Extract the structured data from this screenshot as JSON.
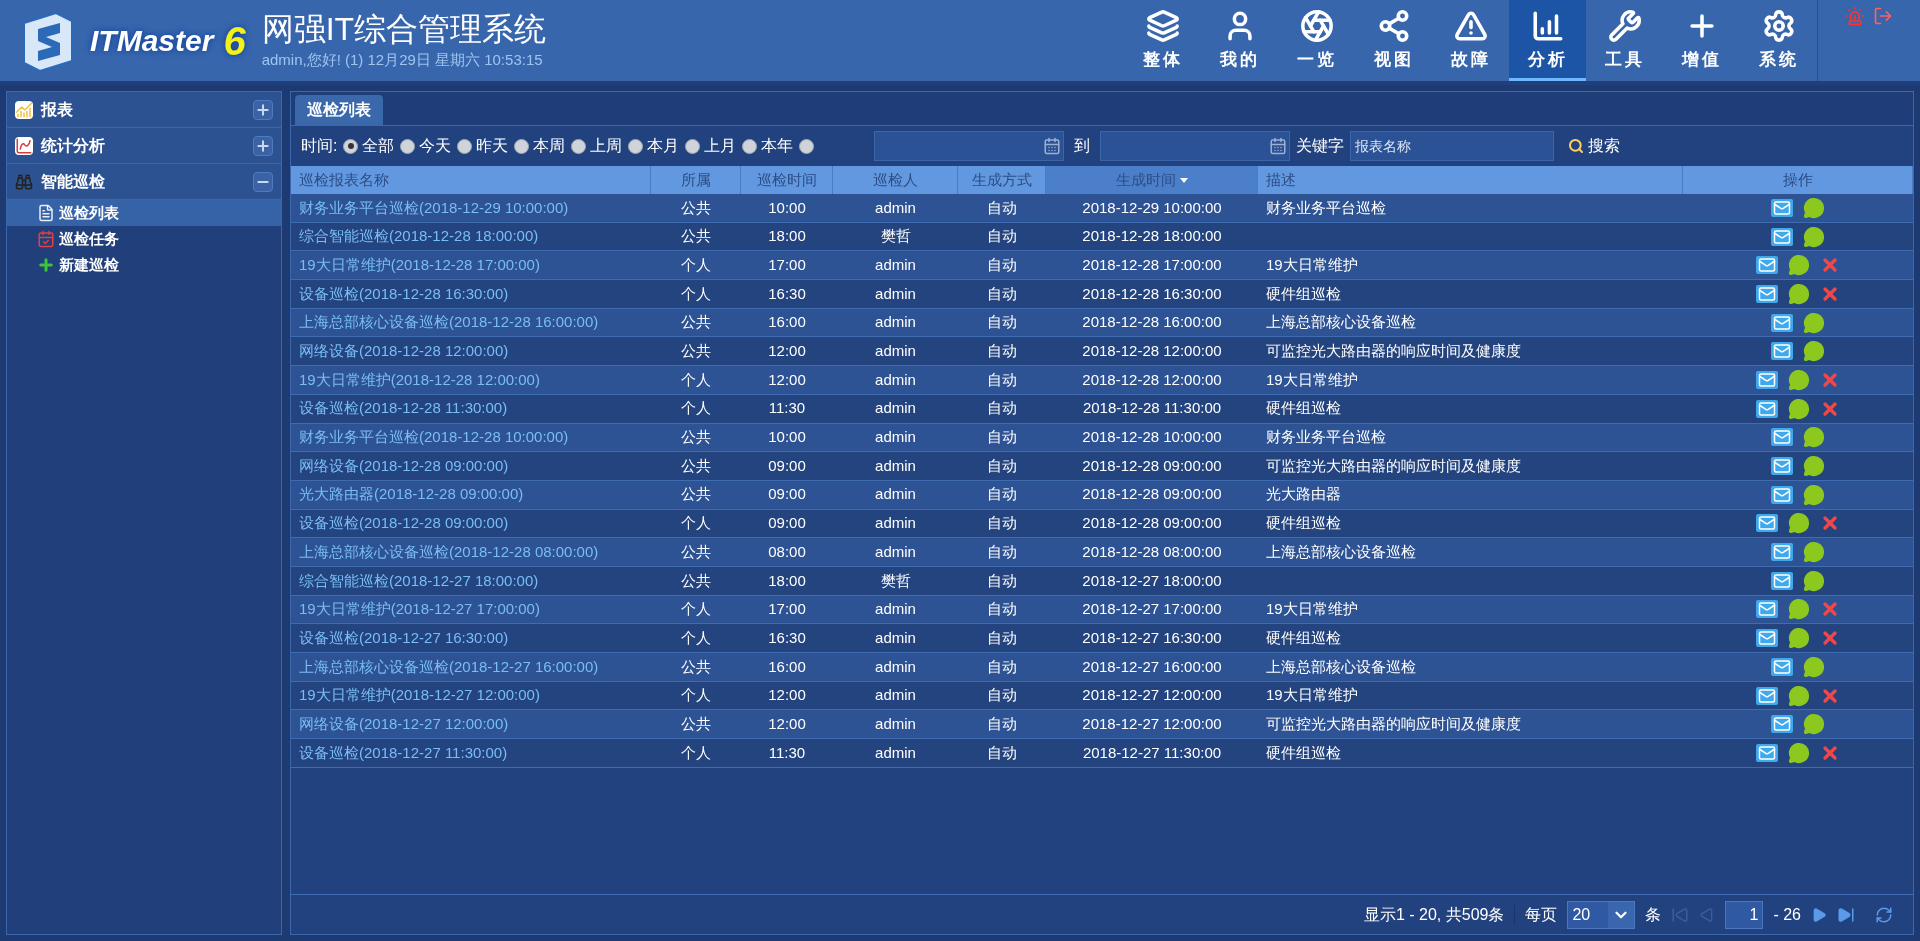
{
  "header": {
    "logo_text": "ITMaster",
    "logo_version": "6",
    "title": "网强IT综合管理系统",
    "subtitle": "admin,您好! (1) 12月29日 星期六 10:53:15"
  },
  "nav": [
    {
      "kind": "layers",
      "label": "整体",
      "selected": false
    },
    {
      "kind": "user",
      "label": "我的",
      "selected": false
    },
    {
      "kind": "overview",
      "label": "一览",
      "selected": false
    },
    {
      "kind": "topology",
      "label": "视图",
      "selected": false
    },
    {
      "kind": "alert",
      "label": "故障",
      "selected": false
    },
    {
      "kind": "chart",
      "label": "分析",
      "selected": true
    },
    {
      "kind": "tools",
      "label": "工具",
      "selected": false
    },
    {
      "kind": "plus",
      "label": "增值",
      "selected": false
    },
    {
      "kind": "gear",
      "label": "系统",
      "selected": false
    }
  ],
  "sidebar": [
    {
      "kind": "report",
      "label": "报表",
      "expanded": false
    },
    {
      "kind": "stats",
      "label": "统计分析",
      "expanded": false
    },
    {
      "kind": "inspect",
      "label": "智能巡检",
      "expanded": true,
      "children": [
        {
          "kind": "list",
          "label": "巡检列表",
          "selected": true
        },
        {
          "kind": "task",
          "label": "巡检任务",
          "selected": false
        },
        {
          "kind": "new",
          "label": "新建巡检",
          "selected": false
        }
      ]
    }
  ],
  "tab": {
    "label": "巡检列表",
    "selected": true
  },
  "filter": {
    "time_label": "时间:",
    "options": [
      {
        "label": "全部",
        "selected": true
      },
      {
        "label": "今天",
        "selected": false
      },
      {
        "label": "昨天",
        "selected": false
      },
      {
        "label": "本周",
        "selected": false
      },
      {
        "label": "上周",
        "selected": false
      },
      {
        "label": "本月",
        "selected": false
      },
      {
        "label": "上月",
        "selected": false
      },
      {
        "label": "本年",
        "selected": false
      }
    ],
    "custom_range_selected": false,
    "to_label": "到",
    "keyword_label": "关键字",
    "keyword_placeholder": "报表名称",
    "search_button": "搜索"
  },
  "table": {
    "columns": [
      {
        "label": "巡检报表名称",
        "sorted": false
      },
      {
        "label": "所属",
        "sorted": false
      },
      {
        "label": "巡检时间",
        "sorted": false
      },
      {
        "label": "巡检人",
        "sorted": false
      },
      {
        "label": "生成方式",
        "sorted": false
      },
      {
        "label": "生成时间",
        "sorted": true
      },
      {
        "label": "描述",
        "sorted": false
      },
      {
        "label": "操作",
        "sorted": false
      }
    ],
    "rows": [
      {
        "name": "财务业务平台巡检(2018-12-29 10:00:00)",
        "owner": "公共",
        "time": "10:00",
        "person": "admin",
        "method": "自动",
        "created": "2018-12-29 10:00:00",
        "desc": "财务业务平台巡检",
        "deletable": false
      },
      {
        "name": "综合智能巡检(2018-12-28 18:00:00)",
        "owner": "公共",
        "time": "18:00",
        "person": "樊哲",
        "method": "自动",
        "created": "2018-12-28 18:00:00",
        "desc": "",
        "deletable": false
      },
      {
        "name": "19大日常维护(2018-12-28 17:00:00)",
        "owner": "个人",
        "time": "17:00",
        "person": "admin",
        "method": "自动",
        "created": "2018-12-28 17:00:00",
        "desc": "19大日常维护",
        "deletable": true
      },
      {
        "name": "设备巡检(2018-12-28 16:30:00)",
        "owner": "个人",
        "time": "16:30",
        "person": "admin",
        "method": "自动",
        "created": "2018-12-28 16:30:00",
        "desc": "硬件组巡检",
        "deletable": true
      },
      {
        "name": "上海总部核心设备巡检(2018-12-28 16:00:00)",
        "owner": "公共",
        "time": "16:00",
        "person": "admin",
        "method": "自动",
        "created": "2018-12-28 16:00:00",
        "desc": "上海总部核心设备巡检",
        "deletable": false
      },
      {
        "name": "网络设备(2018-12-28 12:00:00)",
        "owner": "公共",
        "time": "12:00",
        "person": "admin",
        "method": "自动",
        "created": "2018-12-28 12:00:00",
        "desc": "可监控光大路由器的响应时间及健康度",
        "deletable": false
      },
      {
        "name": "19大日常维护(2018-12-28 12:00:00)",
        "owner": "个人",
        "time": "12:00",
        "person": "admin",
        "method": "自动",
        "created": "2018-12-28 12:00:00",
        "desc": "19大日常维护",
        "deletable": true
      },
      {
        "name": "设备巡检(2018-12-28 11:30:00)",
        "owner": "个人",
        "time": "11:30",
        "person": "admin",
        "method": "自动",
        "created": "2018-12-28 11:30:00",
        "desc": "硬件组巡检",
        "deletable": true
      },
      {
        "name": "财务业务平台巡检(2018-12-28 10:00:00)",
        "owner": "公共",
        "time": "10:00",
        "person": "admin",
        "method": "自动",
        "created": "2018-12-28 10:00:00",
        "desc": "财务业务平台巡检",
        "deletable": false
      },
      {
        "name": "网络设备(2018-12-28 09:00:00)",
        "owner": "公共",
        "time": "09:00",
        "person": "admin",
        "method": "自动",
        "created": "2018-12-28 09:00:00",
        "desc": "可监控光大路由器的响应时间及健康度",
        "deletable": false
      },
      {
        "name": "光大路由器(2018-12-28 09:00:00)",
        "owner": "公共",
        "time": "09:00",
        "person": "admin",
        "method": "自动",
        "created": "2018-12-28 09:00:00",
        "desc": "光大路由器",
        "deletable": false
      },
      {
        "name": "设备巡检(2018-12-28 09:00:00)",
        "owner": "个人",
        "time": "09:00",
        "person": "admin",
        "method": "自动",
        "created": "2018-12-28 09:00:00",
        "desc": "硬件组巡检",
        "deletable": true
      },
      {
        "name": "上海总部核心设备巡检(2018-12-28 08:00:00)",
        "owner": "公共",
        "time": "08:00",
        "person": "admin",
        "method": "自动",
        "created": "2018-12-28 08:00:00",
        "desc": "上海总部核心设备巡检",
        "deletable": false
      },
      {
        "name": "综合智能巡检(2018-12-27 18:00:00)",
        "owner": "公共",
        "time": "18:00",
        "person": "樊哲",
        "method": "自动",
        "created": "2018-12-27 18:00:00",
        "desc": "",
        "deletable": false
      },
      {
        "name": "19大日常维护(2018-12-27 17:00:00)",
        "owner": "个人",
        "time": "17:00",
        "person": "admin",
        "method": "自动",
        "created": "2018-12-27 17:00:00",
        "desc": "19大日常维护",
        "deletable": true
      },
      {
        "name": "设备巡检(2018-12-27 16:30:00)",
        "owner": "个人",
        "time": "16:30",
        "person": "admin",
        "method": "自动",
        "created": "2018-12-27 16:30:00",
        "desc": "硬件组巡检",
        "deletable": true
      },
      {
        "name": "上海总部核心设备巡检(2018-12-27 16:00:00)",
        "owner": "公共",
        "time": "16:00",
        "person": "admin",
        "method": "自动",
        "created": "2018-12-27 16:00:00",
        "desc": "上海总部核心设备巡检",
        "deletable": false
      },
      {
        "name": "19大日常维护(2018-12-27 12:00:00)",
        "owner": "个人",
        "time": "12:00",
        "person": "admin",
        "method": "自动",
        "created": "2018-12-27 12:00:00",
        "desc": "19大日常维护",
        "deletable": true
      },
      {
        "name": "网络设备(2018-12-27 12:00:00)",
        "owner": "公共",
        "time": "12:00",
        "person": "admin",
        "method": "自动",
        "created": "2018-12-27 12:00:00",
        "desc": "可监控光大路由器的响应时间及健康度",
        "deletable": false
      },
      {
        "name": "设备巡检(2018-12-27 11:30:00)",
        "owner": "个人",
        "time": "11:30",
        "person": "admin",
        "method": "自动",
        "created": "2018-12-27 11:30:00",
        "desc": "硬件组巡检",
        "deletable": true
      }
    ]
  },
  "pager": {
    "summary": "显示1 - 20, 共509条",
    "per_page_label": "每页",
    "per_page": "20",
    "unit": "条",
    "page": "1",
    "total": "- 26"
  }
}
